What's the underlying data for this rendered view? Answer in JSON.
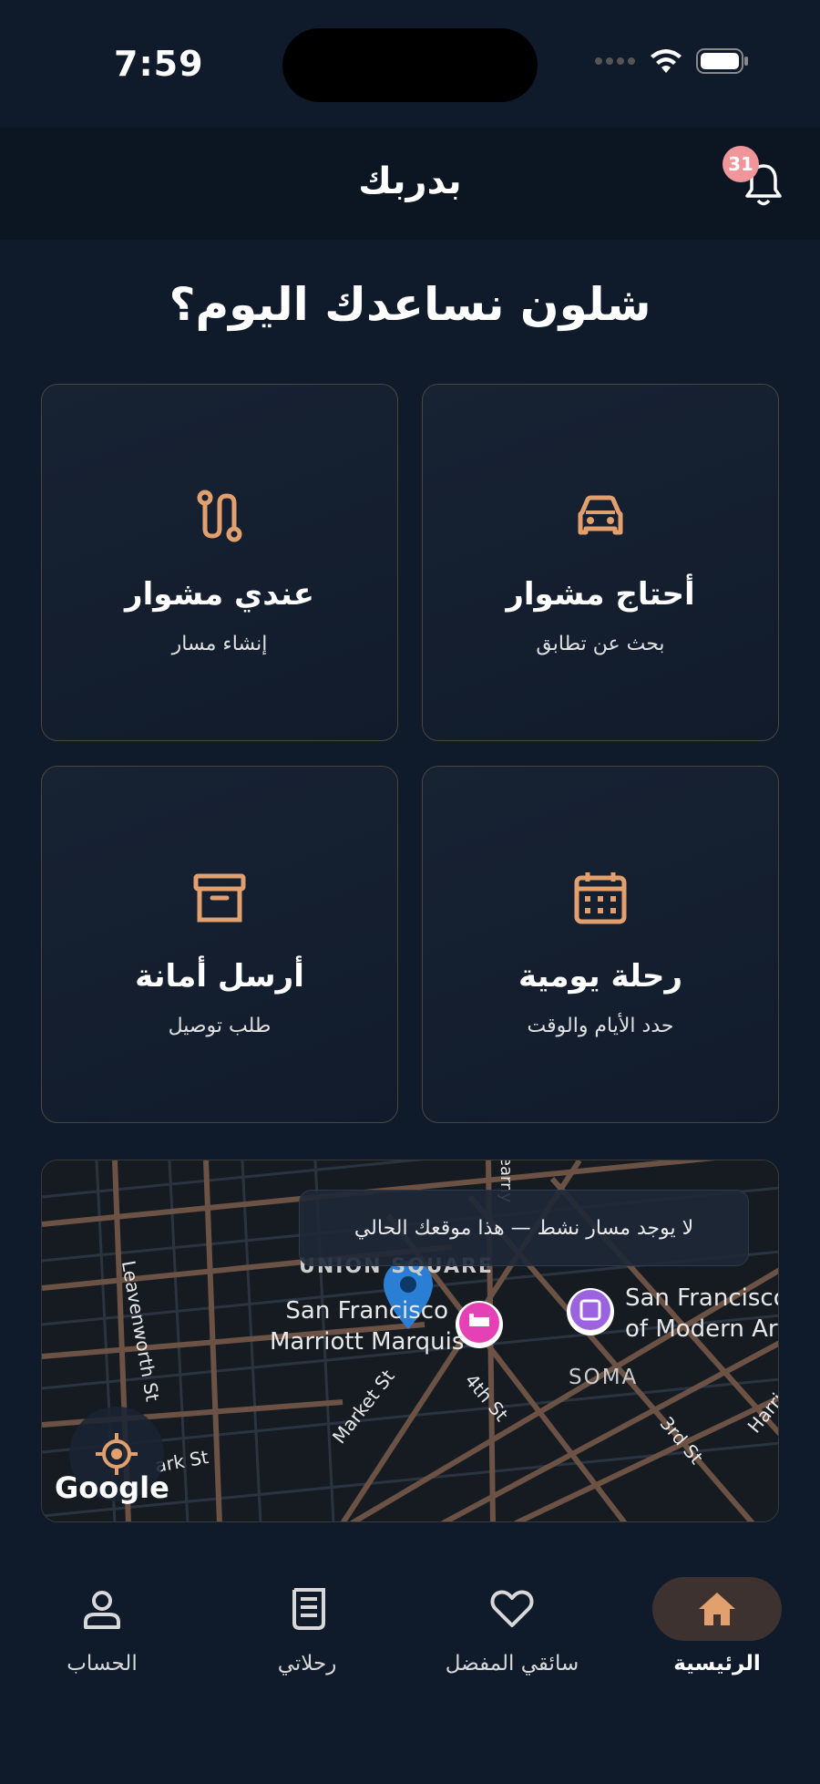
{
  "status_bar": {
    "time": "7:59"
  },
  "header": {
    "title": "بدربك",
    "notifications_count": "31"
  },
  "greeting": "شلون نساعدك اليوم؟",
  "cards": [
    {
      "title": "أحتاج مشوار",
      "subtitle": "بحث عن تطابق",
      "icon": "car-icon"
    },
    {
      "title": "عندي مشوار",
      "subtitle": "إنشاء مسار",
      "icon": "route-icon"
    },
    {
      "title": "رحلة يومية",
      "subtitle": "حدد الأيام والوقت",
      "icon": "calendar-icon"
    },
    {
      "title": "أرسل أمانة",
      "subtitle": "طلب توصيل",
      "icon": "archive-box-icon"
    }
  ],
  "map": {
    "banner": "لا يوجد مسار نشط — هذا موقعك الحالي",
    "provider": "Google",
    "labels": {
      "union_square": "UNION SQUARE",
      "marriott_1": "San Francisco",
      "marriott_2": "Marriott Marquis",
      "museum_1": "San Francisco",
      "museum_2": "of Modern Art",
      "soma": "SOMA",
      "leavenworth": "Leavenworth St",
      "market": "Market St",
      "fourth": "4th St",
      "third": "3rd St",
      "park": "ark St",
      "harrison": "Harri",
      "kearny": "earny"
    }
  },
  "bottom_nav": [
    {
      "label": "الرئيسية",
      "icon": "home-icon",
      "active": true
    },
    {
      "label": "سائقي المفضل",
      "icon": "heart-icon",
      "active": false
    },
    {
      "label": "رحلاتي",
      "icon": "receipt-icon",
      "active": false
    },
    {
      "label": "الحساب",
      "icon": "person-icon",
      "active": false
    }
  ],
  "colors": {
    "accent": "#e2a06e",
    "background": "#0f1a2b",
    "badge": "#f0959a",
    "nav_active_bg": "#3d322f"
  }
}
